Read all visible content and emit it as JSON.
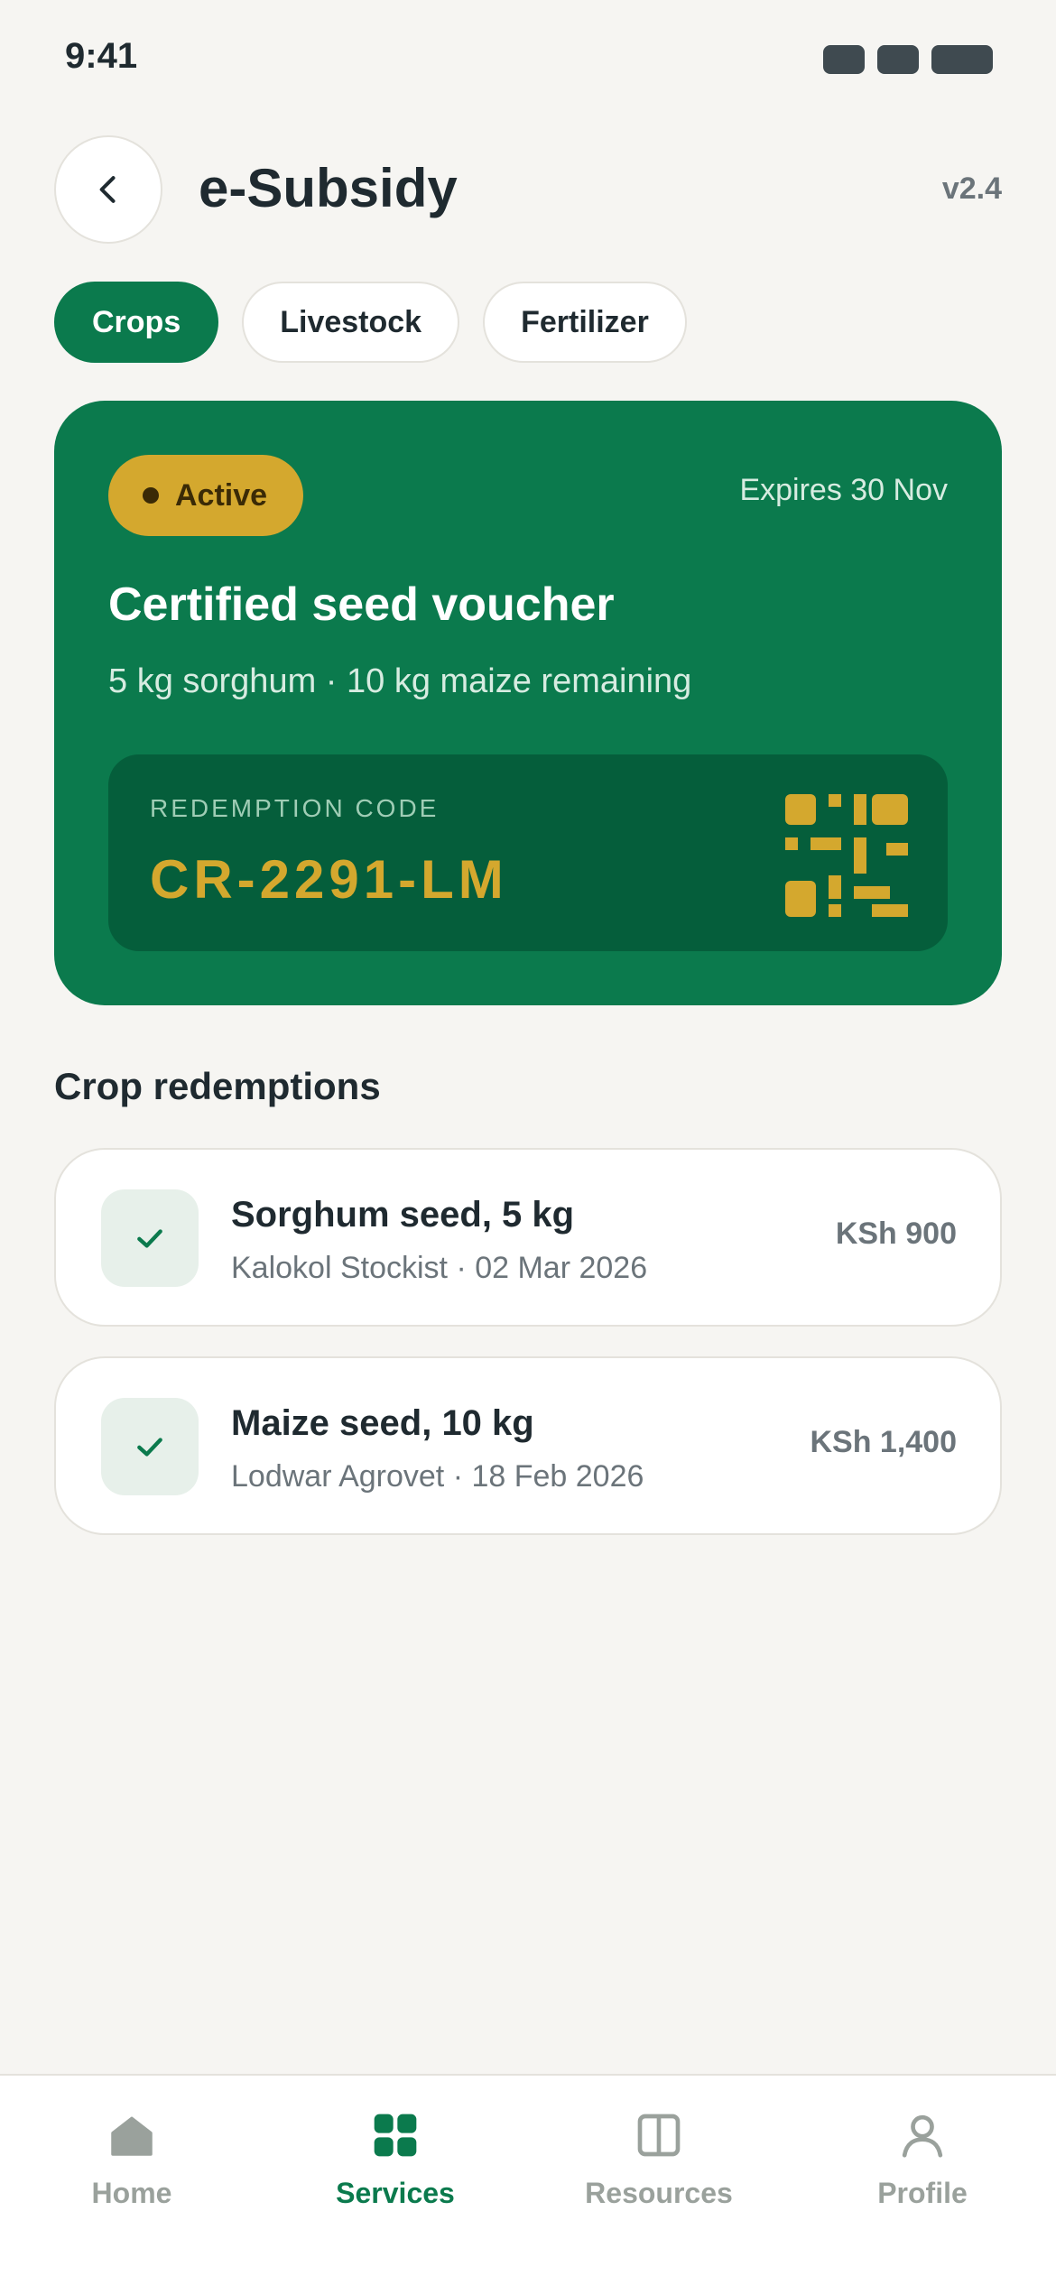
{
  "status_bar": {
    "time": "9:41"
  },
  "header": {
    "title": "e-Subsidy",
    "version": "v2.4"
  },
  "tabs": [
    {
      "label": "Crops",
      "active": true
    },
    {
      "label": "Livestock",
      "active": false
    },
    {
      "label": "Fertilizer",
      "active": false
    }
  ],
  "voucher": {
    "status": "Active",
    "expires": "Expires 30 Nov",
    "title": "Certified seed voucher",
    "subtitle": "5 kg sorghum · 10 kg maize remaining",
    "code_label": "REDEMPTION CODE",
    "code": "CR-2291-LM"
  },
  "redemptions": {
    "title": "Crop redemptions",
    "items": [
      {
        "title": "Sorghum seed, 5 kg",
        "subtitle": "Kalokol Stockist · 02 Mar 2026",
        "amount": "KSh 900"
      },
      {
        "title": "Maize seed, 10 kg",
        "subtitle": "Lodwar Agrovet · 18 Feb 2026",
        "amount": "KSh 1,400"
      }
    ]
  },
  "bottom_nav": [
    {
      "label": "Home",
      "icon": "home-icon",
      "active": false
    },
    {
      "label": "Services",
      "icon": "grid-icon",
      "active": true
    },
    {
      "label": "Resources",
      "icon": "book-icon",
      "active": false
    },
    {
      "label": "Profile",
      "icon": "user-icon",
      "active": false
    }
  ],
  "colors": {
    "brand_green": "#0b7a4d",
    "dark_green": "#055e3b",
    "gold": "#d4a82e",
    "background": "#f6f5f2",
    "muted_text": "#6b747a"
  }
}
